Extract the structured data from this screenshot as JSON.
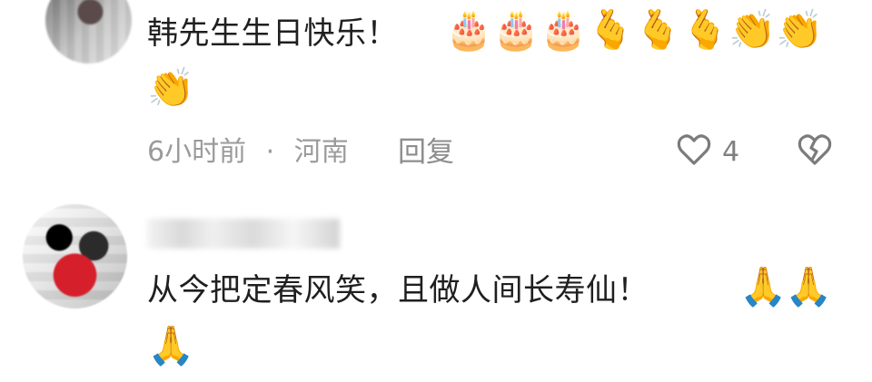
{
  "comments": [
    {
      "text": "韩先生生日快乐！",
      "emoji_count": 10,
      "meta": {
        "time": "6小时前",
        "separator": "·",
        "location": "河南"
      },
      "actions": {
        "reply_label": "回复",
        "like_count": "4"
      },
      "icons": {
        "like": "heart-outline-icon",
        "dislike": "broken-heart-icon"
      }
    },
    {
      "text": "从今把定春风笑，且做人间长寿仙！",
      "emoji_count": 3
    }
  ],
  "emojis": {
    "cake": "🎂",
    "finger_heart": "🫰",
    "clap": "👏",
    "pray": "🙏"
  },
  "colors": {
    "text": "#1f1f1f",
    "meta": "#9b9b9b",
    "icon": "#7b7b7b",
    "background": "#ffffff"
  }
}
